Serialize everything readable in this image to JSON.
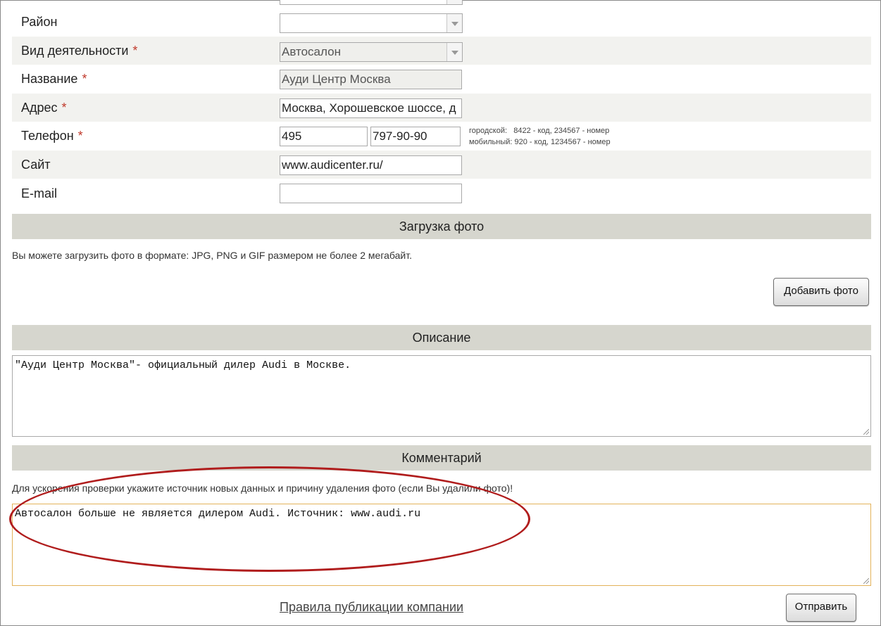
{
  "form": {
    "district": {
      "label": "Район",
      "value": ""
    },
    "activity": {
      "label": "Вид деятельности",
      "required_mark": "*",
      "value": "Автосалон"
    },
    "name": {
      "label": "Название",
      "required_mark": "*",
      "value": "Ауди Центр Москва"
    },
    "address": {
      "label": "Адрес",
      "required_mark": "*",
      "value": "Москва, Хорошевское шоссе, д"
    },
    "phone": {
      "label": "Телефон",
      "required_mark": "*",
      "code": "495",
      "number": "797-90-90",
      "hint_city": "городской:   8422 - код, 234567 - номер",
      "hint_mobile": "мобильный: 920 - код, 1234567 - номер"
    },
    "site": {
      "label": "Сайт",
      "value": "www.audicenter.ru/"
    },
    "email": {
      "label": "E-mail",
      "value": ""
    }
  },
  "photo": {
    "title": "Загрузка фото",
    "note": "Вы можете загрузить фото в формате: JPG, PNG и GIF размером не более 2 мегабайт.",
    "add_button": "Добавить фото"
  },
  "description": {
    "title": "Описание",
    "text": "\"Ауди Центр Москва\"- официальный дилер Audi в Москве."
  },
  "comment": {
    "title": "Комментарий",
    "note": "Для ускорения проверки укажите источник новых данных и причину удаления фото (если Вы удалили фото)!",
    "text": "Автосалон больше не является дилером Audi. Источник: www.audi.ru"
  },
  "footer": {
    "rules_link": "Правила публикации компании",
    "submit_button": "Отправить"
  },
  "colors": {
    "section_bar": "#d6d6ce",
    "row_shade": "#f2f2ef",
    "required": "#c0392b",
    "annotation": "#b01c1c",
    "focus_border": "#e3b25a"
  }
}
